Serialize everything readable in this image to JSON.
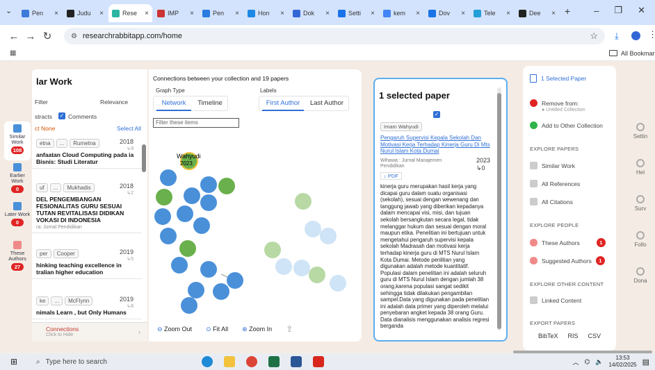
{
  "browser": {
    "tabs": [
      {
        "label": "Pen",
        "color": "#3c7bd9"
      },
      {
        "label": "Judu",
        "color": "#222"
      },
      {
        "label": "Rese",
        "color": "#2db5a3"
      },
      {
        "label": "IMP",
        "color": "#c33"
      },
      {
        "label": "Pen",
        "color": "#2a7ce0"
      },
      {
        "label": "Hon",
        "color": "#1e88e5"
      },
      {
        "label": "Dok",
        "color": "#3367d6"
      },
      {
        "label": "Setti",
        "color": "#1a73e8"
      },
      {
        "label": "kem",
        "color": "#4285f4"
      },
      {
        "label": "Dov",
        "color": "#1a73e8"
      },
      {
        "label": "Tele",
        "color": "#229ed9"
      },
      {
        "label": "Dee",
        "color": "#222"
      }
    ],
    "close_glyph": "×",
    "new_tab": "+",
    "url": "researchrabbitapp.com/home",
    "all_bookmarks": "All Bookmarks"
  },
  "rail": [
    {
      "label": "Similar Work",
      "count": "108"
    },
    {
      "label": "Earlier Work",
      "count": "0"
    },
    {
      "label": "Later Work",
      "count": "0"
    },
    {
      "label": "These Authors",
      "count": "27"
    }
  ],
  "list": {
    "title": "lar Work",
    "filter_placeholder": "Filter",
    "sort": "Relevance",
    "abstracts": "stracts",
    "comments": "Comments",
    "select_none": "ct None",
    "select_all": "Select All",
    "cards": [
      {
        "authors": [
          "etna",
          "...",
          "Rumetna"
        ],
        "year": "2018",
        "cites": "↳9",
        "title": "anfaatan Cloud Computing pada ia Bisnis: Studi Literatur",
        "venue": ""
      },
      {
        "authors": [
          "uf",
          "...",
          "Mukhadis"
        ],
        "year": "2018",
        "cites": "↳2",
        "title": "DEL PENGEMBANGAN FESIONALITAS GURU SESUAI TUTAN REVITALISASI DIDIKAN VOKASI DI INDONESIA",
        "venue": "ra: Jurnal Pendidikan"
      },
      {
        "authors": [
          "per",
          "Cooper"
        ],
        "year": "2019",
        "cites": "↳5",
        "title": "hinking teaching excellence in tralian higher education",
        "venue": ""
      },
      {
        "authors": [
          "ke",
          "...",
          "McFlynn"
        ],
        "year": "2019",
        "cites": "↳8",
        "title": "nimals Learn , but Only Humans",
        "venue": ""
      }
    ],
    "connections": "Connections",
    "click_hide": "Click to Hide"
  },
  "graph": {
    "header": "Connections between your collection and 19 papers",
    "graph_type_label": "Graph Type",
    "network": "Network",
    "timeline": "Timeline",
    "labels_label": "Labels",
    "first_author": "First Author",
    "last_author": "Last Author",
    "filter_placeholder": "Filter these items",
    "selected_node_label": "Wahyudi",
    "selected_node_year": "2023",
    "zoom_out": "Zoom Out",
    "fit_all": "Fit All",
    "zoom_in": "Zoom In"
  },
  "selected": {
    "title": "1 selected paper",
    "author_chip": "Imam Wahyudi",
    "paper_title": "Pengaruh Supervisi Kepala Sekolah Dan Motivasi Kerja Terhadap Kinerja Guru Di Mts Nurul Islam Kota Dumai",
    "venue": "Wihawa : Jurnal Manajemen Pendidikan",
    "year": "2023",
    "cites": "↳0",
    "pdf": "↓ PDF",
    "abstract": "kinerja guru merupakan hasil kerja yang dicapai guru dalam suatu organisasi (sekolah), sesuai dengan wewenang dan tanggung jawab yang diberikan kepadanya dalam mencapai visi, misi, dan tujuan sekolah bersangkutan secara legal, tidak melanggar hukum dan sesuai dengan moral maupun etika. Penelitian ini bertujuan untuk mengetahui pengaruh supervisi kepala sekolah Madrasah dan motivasi kerja terhadap kinerja guru di MTS Nurul Islam Kota Dumai. Metode penlitian yang digunakan adalah metode kuantitatif. Populasi dalam penelitian ini adalah seluruh guru di MTS Nurul Islam dengan jumlah 38 orang,karena populasi sangat sedikit sehingga tidak dilakukan pengambilan sampel.Data yang digunakan pada penelitian ini adalah data primer yang diperoleh melalui penyebaran angket kepada 38 orang Guru. Data dianalisis menggunakan analisis regresi berganda"
  },
  "menu": {
    "selected_paper": "1 Selected Paper",
    "remove_from": "Remove from:",
    "untitled": "● Untitled Collection",
    "add_to_other": "Add to Other Collection",
    "explore_papers": "EXPLORE PAPERS",
    "similar_work": "Similar Work",
    "all_references": "All References",
    "all_citations": "All Citations",
    "explore_people": "EXPLORE PEOPLE",
    "these_authors": "These Authors",
    "these_authors_count": "1",
    "suggested_authors": "Suggested Authors",
    "suggested_authors_count": "1",
    "explore_other": "EXPLORE OTHER CONTENT",
    "linked_content": "Linked Content",
    "export_papers": "EXPORT PAPERS",
    "bibtex": "BibTeX",
    "ris": "RIS",
    "csv": "CSV"
  },
  "settings": [
    "Settin",
    "Hel",
    "Surv",
    "Follo",
    "Dona"
  ],
  "taskbar": {
    "search_placeholder": "Type here to search",
    "time": "13:53",
    "date": "14/02/2025"
  }
}
